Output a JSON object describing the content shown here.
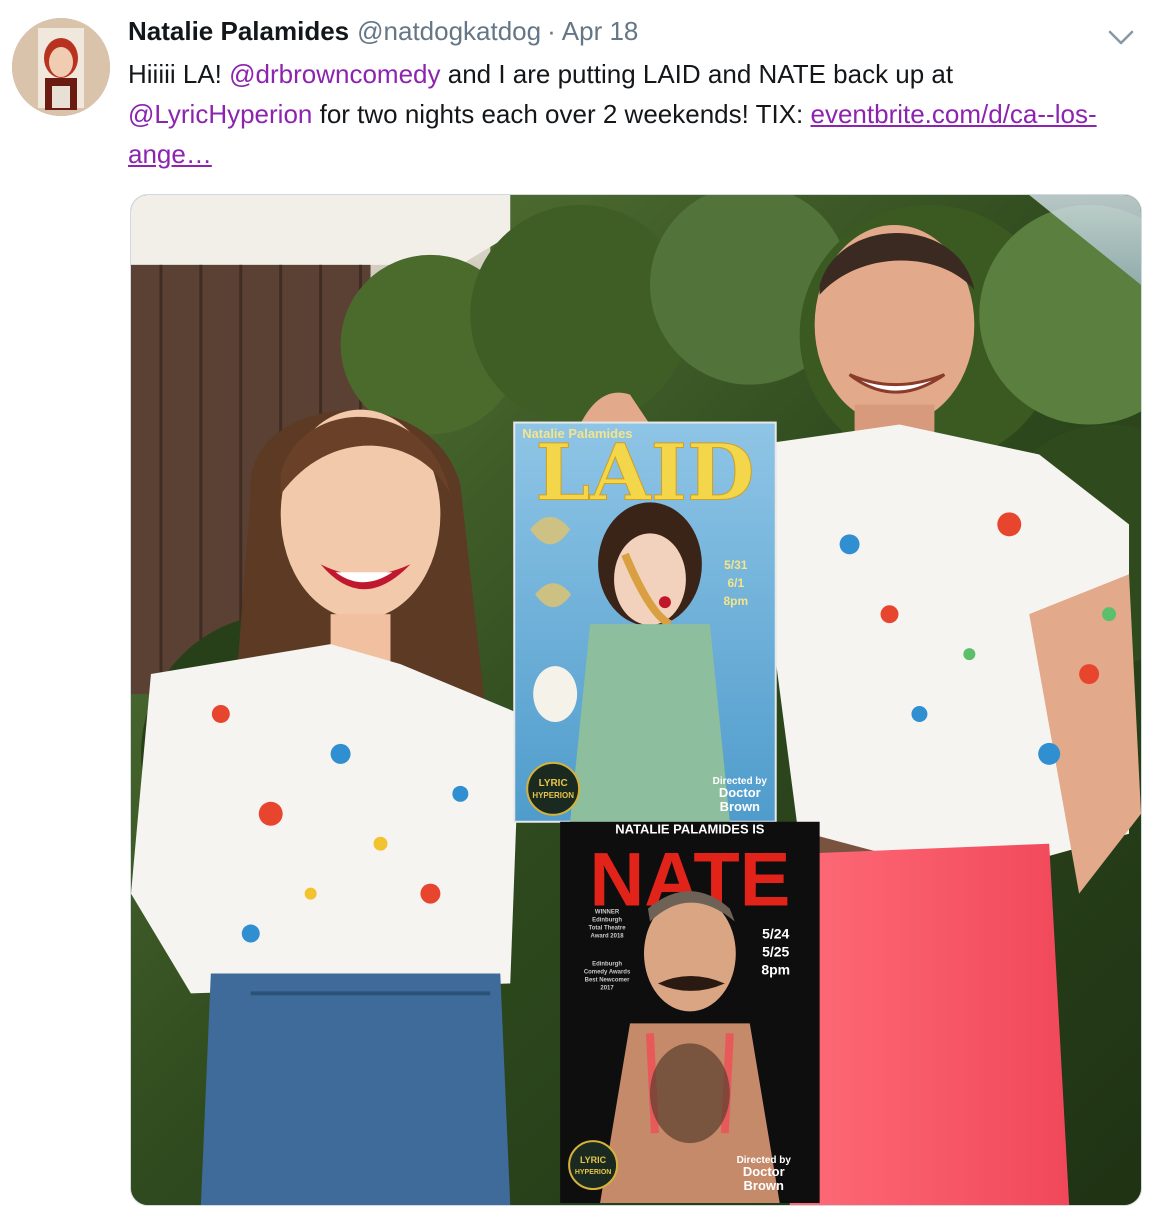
{
  "tweet": {
    "display_name": "Natalie Palamides",
    "handle": "@natdogkatdog",
    "separator": "·",
    "date": "Apr 18",
    "text_1": "Hiiiii LA! ",
    "mention_1": "@drbrowncomedy",
    "text_2": " and I are putting LAID and NATE back up at ",
    "mention_2": "@LyricHyperion",
    "text_3": " for two nights each over 2 weekends! TIX: ",
    "link": "eventbrite.com/d/ca--los-ange…"
  },
  "media": {
    "laid_poster": {
      "top_name": "Natalie Palamides",
      "title": "LAID",
      "dates": [
        "5/31",
        "6/1",
        "8pm"
      ],
      "venue": [
        "LYRIC",
        "HYPERION"
      ],
      "credit": [
        "Directed by",
        "Doctor",
        "Brown"
      ]
    },
    "nate_poster": {
      "top_line": "NATALIE PALAMIDES IS",
      "title": "NATE",
      "dates": [
        "5/24",
        "5/25",
        "8pm"
      ],
      "laurel_1": [
        "WINNER",
        "Edinburgh",
        "Total Theatre",
        "Award 2018"
      ],
      "laurel_2": [
        "Edinburgh",
        "Comedy Awards",
        "Best Newcomer",
        "2017"
      ],
      "venue": [
        "LYRIC",
        "HYPERION"
      ],
      "credit": [
        "Directed by",
        "Doctor",
        "Brown"
      ]
    }
  },
  "colors": {
    "mention": "#8c24b0",
    "muted": "#657786",
    "text": "#14171a"
  }
}
